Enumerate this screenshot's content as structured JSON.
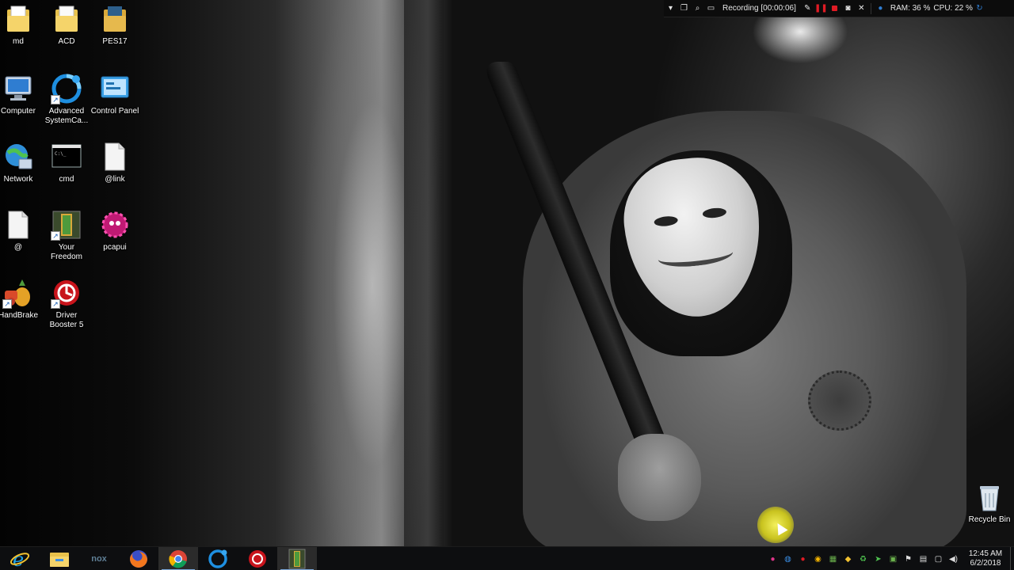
{
  "desktop": {
    "icons": [
      {
        "label": "md",
        "icon": "folder-icon"
      },
      {
        "label": "ACD",
        "icon": "folder-icon"
      },
      {
        "label": "PES17",
        "icon": "folder-icon"
      },
      {
        "label": "Computer",
        "icon": "computer-icon"
      },
      {
        "label": "Advanced SystemCa...",
        "icon": "advanced-systemcare-icon"
      },
      {
        "label": "Control Panel",
        "icon": "control-panel-icon"
      },
      {
        "label": "Network",
        "icon": "network-icon"
      },
      {
        "label": "cmd",
        "icon": "cmd-icon"
      },
      {
        "label": "@link",
        "icon": "file-icon"
      },
      {
        "label": "@",
        "icon": "file-icon"
      },
      {
        "label": "Your Freedom",
        "icon": "your-freedom-icon"
      },
      {
        "label": "pcapui",
        "icon": "pcapui-icon"
      },
      {
        "label": "HandBrake",
        "icon": "handbrake-icon"
      },
      {
        "label": "Driver Booster 5",
        "icon": "driver-booster-icon"
      },
      {
        "label": "Recycle Bin",
        "icon": "recycle-bin-icon"
      }
    ]
  },
  "recorder": {
    "status": "Recording [00:00:06]",
    "ram": "RAM: 36 %",
    "cpu": "CPU: 22 %"
  },
  "taskbar": {
    "apps": [
      {
        "name": "internet-explorer",
        "icon": "ie-icon"
      },
      {
        "name": "file-explorer",
        "icon": "folder-icon"
      },
      {
        "name": "nox",
        "icon": "nox-icon",
        "text": "nox"
      },
      {
        "name": "firefox",
        "icon": "firefox-icon"
      },
      {
        "name": "chrome",
        "icon": "chrome-icon"
      },
      {
        "name": "advanced-systemcare",
        "icon": "advanced-systemcare-icon"
      },
      {
        "name": "driver-booster",
        "icon": "driver-booster-icon"
      },
      {
        "name": "your-freedom",
        "icon": "your-freedom-icon"
      }
    ],
    "clock_time": "12:45 AM",
    "clock_date": "6/2/2018"
  },
  "colors": {
    "taskbar_bg": "#0d0e10",
    "active_indicator": "#7aa6d8",
    "record_red": "#e01b24",
    "cursor_highlight": "#f3f05a"
  }
}
